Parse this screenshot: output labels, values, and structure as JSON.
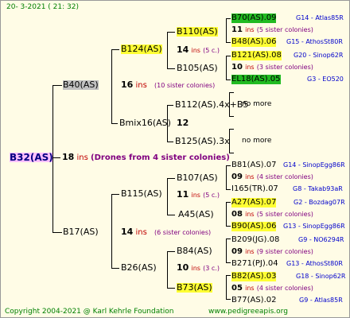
{
  "header": {
    "date": "20-  3-2021 ( 21: 32)"
  },
  "footer": {
    "copyright": "Copyright 2004-2021 @ Karl Kehrle Foundation",
    "url": "www.pedigreeapis.org"
  },
  "root": {
    "label": "B32(AS)",
    "count": "18",
    "ins": "ins",
    "drones": "(Drones from 4 sister colonies)"
  },
  "gen1": {
    "upper": {
      "label": "B40(AS)",
      "count": "16",
      "ins": "ins",
      "sis": "(10 sister colonies)"
    },
    "lower": {
      "label": "B17(AS)",
      "count": "14",
      "ins": "ins",
      "sis": "(6 sister colonies)"
    }
  },
  "gen2": {
    "a": {
      "label": "B124(AS)",
      "count": "14",
      "ins": "ins",
      "sis": "(5 c.)"
    },
    "b": {
      "label": "Bmix16(AS)",
      "count": "12"
    },
    "c": {
      "label": "B115(AS)",
      "count": "11",
      "ins": "ins",
      "sis": "(5 c.)"
    },
    "d": {
      "label": "B26(AS)",
      "count": "10",
      "ins": "ins",
      "sis": "(3 c.)"
    }
  },
  "gen3": {
    "a1": {
      "label": "B110(AS)"
    },
    "a2": {
      "label": "B105(AS)"
    },
    "b1": {
      "label": "B112(AS).4x+B5"
    },
    "b2": {
      "label": "B125(AS).3x"
    },
    "c1": {
      "label": "B107(AS)"
    },
    "c2": {
      "label": "A45(AS)"
    },
    "d1": {
      "label": "B84(AS)"
    },
    "d2": {
      "label": "B73(AS)"
    }
  },
  "gen4": [
    {
      "label": "B70(AS).09",
      "count": "",
      "ins": "",
      "sis": "",
      "right": "G14 - Atlas85R"
    },
    {
      "label": "",
      "count": "11",
      "ins": "ins",
      "sis": "(5 sister colonies)",
      "right": ""
    },
    {
      "label": "B48(AS).06",
      "count": "",
      "ins": "",
      "sis": "",
      "right": "G15 - AthosSt80R"
    },
    {
      "label": "B121(AS).08",
      "count": "",
      "ins": "",
      "sis": "",
      "right": "G20 - Sinop62R"
    },
    {
      "label": "",
      "count": "10",
      "ins": "ins",
      "sis": "(3 sister colonies)",
      "right": ""
    },
    {
      "label": "EL18(AS).05",
      "count": "",
      "ins": "",
      "sis": "",
      "right": "G3 - EO520"
    },
    {
      "label": "no more",
      "right": ""
    },
    {
      "label": "no more",
      "right": ""
    },
    {
      "label": "B81(AS).07",
      "count": "",
      "ins": "",
      "sis": "",
      "right": "G14 - SinopEgg86R"
    },
    {
      "label": "",
      "count": "09",
      "ins": "ins",
      "sis": "(4 sister colonies)",
      "right": ""
    },
    {
      "label": "I165(TR).07",
      "count": "",
      "ins": "",
      "sis": "",
      "right": "G8 - Takab93aR"
    },
    {
      "label": "A27(AS).07",
      "count": "",
      "ins": "",
      "sis": "",
      "right": "G2 - Bozdag07R"
    },
    {
      "label": "",
      "count": "08",
      "ins": "ins",
      "sis": "(5 sister colonies)",
      "right": ""
    },
    {
      "label": "B90(AS).06",
      "count": "",
      "ins": "",
      "sis": "",
      "right": "G13 - SinopEgg86R"
    },
    {
      "label": "B209(JG).08",
      "count": "",
      "ins": "",
      "sis": "",
      "right": "G9 - NO6294R"
    },
    {
      "label": "",
      "count": "09",
      "ins": "ins",
      "sis": "(9 sister colonies)",
      "right": ""
    },
    {
      "label": "B271(PJ).04",
      "count": "",
      "ins": "",
      "sis": "",
      "right": "G13 - AthosSt80R"
    },
    {
      "label": "B82(AS).03",
      "count": "",
      "ins": "",
      "sis": "",
      "right": "G18 - Sinop62R"
    },
    {
      "label": "",
      "count": "05",
      "ins": "ins",
      "sis": "(4 sister colonies)",
      "right": ""
    },
    {
      "label": "B77(AS).02",
      "count": "",
      "ins": "",
      "sis": "",
      "right": "G9 - Atlas85R"
    }
  ],
  "colors": {
    "background": "#fffce6",
    "highlight": "#ffff33",
    "green": "#22bb22",
    "gray": "#c0c0c0",
    "root_bg": "#ffc0ff",
    "ins": "#c00000",
    "purple": "#800080",
    "blue": "#0000cc",
    "footer": "#008000"
  }
}
